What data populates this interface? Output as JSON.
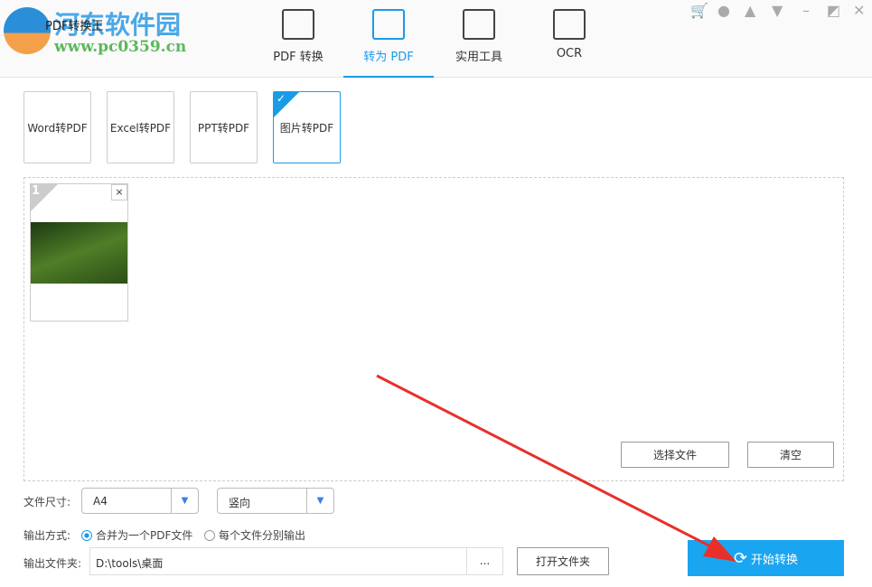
{
  "app": {
    "title": "PDF转换王",
    "watermark_name": "河东软件园",
    "watermark_url": "www.pc0359.cn"
  },
  "nav": [
    {
      "label": "PDF 转换",
      "icon": "pdf-convert-icon"
    },
    {
      "label": "转为 PDF",
      "icon": "to-pdf-icon"
    },
    {
      "label": "实用工具",
      "icon": "tools-icon"
    },
    {
      "label": "OCR",
      "icon": "ocr-icon"
    }
  ],
  "window_controls": [
    "cart-icon",
    "user-icon",
    "bell-icon",
    "menu-icon",
    "minimize-icon",
    "maximize-icon",
    "close-icon"
  ],
  "convert_tabs": [
    "Word转PDF",
    "Excel转PDF",
    "PPT转PDF",
    "图片转PDF"
  ],
  "files": [
    {
      "index": "1",
      "remove": "×"
    }
  ],
  "buttons": {
    "select_files": "选择文件",
    "clear": "清空",
    "browse": "...",
    "open_folder": "打开文件夹",
    "start": "开始转换"
  },
  "options": {
    "size_label": "文件尺寸:",
    "size_value": "A4",
    "orientation_value": "竖向",
    "output_mode_label": "输出方式:",
    "mode_merge": "合并为一个PDF文件",
    "mode_separate": "每个文件分别输出",
    "output_folder_label": "输出文件夹:",
    "output_folder_value": "D:\\tools\\桌面"
  }
}
